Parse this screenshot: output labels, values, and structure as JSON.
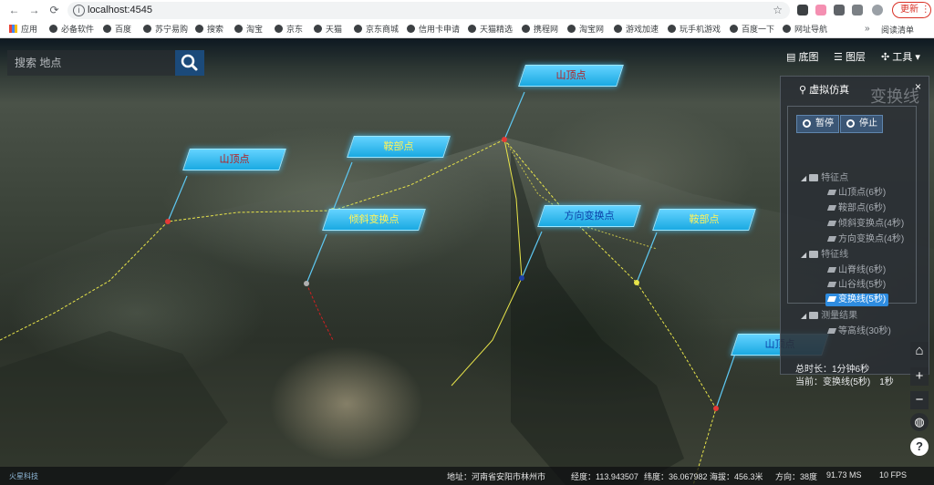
{
  "browser": {
    "url": "localhost:4545",
    "update_label": "更新",
    "bookmarks": [
      "应用",
      "必备软件",
      "百度",
      "苏宁易购",
      "搜索",
      "淘宝",
      "京东",
      "天猫",
      "京东商城",
      "信用卡申请",
      "天猫精选",
      "携程网",
      "淘宝网",
      "游戏加速",
      "玩手机游戏",
      "百度一下",
      "网址导航"
    ],
    "more": "»",
    "reading_list": "阅读清单"
  },
  "search": {
    "placeholder": "搜索 地点"
  },
  "top_menu": {
    "basemap": "底图",
    "layers": "图层",
    "tools": "工具"
  },
  "map_labels": [
    {
      "text": "山顶点",
      "color": "red"
    },
    {
      "text": "山顶点",
      "color": "red"
    },
    {
      "text": "鞍部点",
      "color": "yellow"
    },
    {
      "text": "倾斜变换点",
      "color": "yellow"
    },
    {
      "text": "方向变换点",
      "color": "blue"
    },
    {
      "text": "鞍部点",
      "color": "yellow"
    },
    {
      "text": "山顶点",
      "color": "blue"
    }
  ],
  "sim_panel": {
    "title": "虚拟仿真",
    "big_title": "变换线",
    "close": "×",
    "pause": "暂停",
    "stop": "停止",
    "groups": [
      {
        "label": "特征点",
        "items": [
          "山顶点(6秒)",
          "鞍部点(6秒)",
          "倾斜变换点(4秒)",
          "方向变换点(4秒)"
        ]
      },
      {
        "label": "特征线",
        "items": [
          "山脊线(6秒)",
          "山谷线(5秒)",
          "变换线(5秒)"
        ]
      },
      {
        "label": "测量结果",
        "items": [
          "等高线(30秒)"
        ]
      }
    ],
    "total": "总时长：1分钟6秒",
    "current": "当前：变换线(5秒)　1秒"
  },
  "zoom": {
    "plus": "+",
    "minus": "−",
    "help": "?"
  },
  "status": {
    "logo": "火星科技",
    "address": "地址：河南省安阳市林州市",
    "lon": "经度：113.943507",
    "lat": "纬度：36.067982",
    "alt": "海拔：456.3米",
    "heading": "方向：38度",
    "ms": "91.73 MS",
    "fps": "10 FPS"
  },
  "colors": {
    "label_fill": "#29b6f6",
    "panel_bg": "#2a2f34",
    "active_item": "#2e8ce0",
    "sim_button": "#3b5675",
    "search_button": "#1b4a7a"
  },
  "icons": [
    "back-arrow-icon",
    "forward-arrow-icon",
    "reload-icon",
    "info-icon",
    "star-icon",
    "search-icon",
    "map-icon",
    "layers-icon",
    "tools-icon",
    "pin-icon",
    "folder-icon",
    "tag-icon",
    "globe-icon",
    "help-icon"
  ]
}
